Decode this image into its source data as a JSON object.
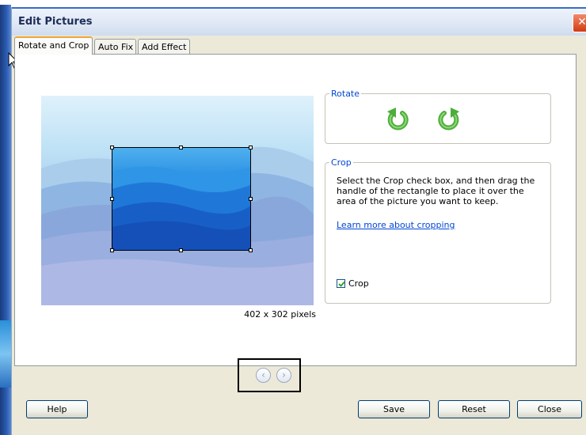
{
  "window": {
    "title": "Edit Pictures",
    "close_glyph": "✕"
  },
  "tabs": [
    {
      "label": "Rotate and Crop",
      "active": true
    },
    {
      "label": "Auto Fix",
      "active": false
    },
    {
      "label": "Add Effect",
      "active": false
    }
  ],
  "preview": {
    "dimensions": "402 x 302 pixels",
    "crop_enabled": true
  },
  "rotate": {
    "legend": "Rotate",
    "left_icon": "rotate-counterclockwise-icon",
    "right_icon": "rotate-clockwise-icon",
    "icon_color": "#4cae3a"
  },
  "crop": {
    "legend": "Crop",
    "description": "Select the Crop check box, and then drag the handle of the rectangle to place it over the area of the picture you want to keep.",
    "learn_more": "Learn more about cropping",
    "checkbox_label": "Crop",
    "checked": true
  },
  "nav": {
    "prev_icon": "chevron-left-icon",
    "next_icon": "chevron-right-icon"
  },
  "buttons": {
    "help": "Help",
    "save": "Save",
    "reset": "Reset",
    "close": "Close"
  },
  "colors": {
    "accent_tab": "#f1a33b",
    "link": "#0046d5",
    "titlebar_border": "#3a6cc6"
  }
}
